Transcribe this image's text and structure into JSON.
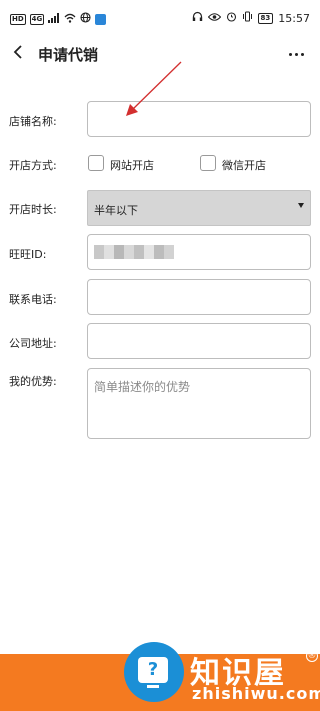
{
  "status_bar": {
    "left_tags": [
      "HD",
      "4G"
    ],
    "left_icons": [
      "signal-icon",
      "wifi-icon",
      "globe-icon",
      "app-icon"
    ],
    "right_icons": [
      "headphones-icon",
      "eye-icon",
      "alarm-icon",
      "vibrate-icon"
    ],
    "battery": "83",
    "time": "15:57"
  },
  "app_bar": {
    "title": "申请代销",
    "back_icon": "chevron-left-icon",
    "more_icon": "more-dots-icon"
  },
  "form": {
    "shop_name": {
      "label": "店铺名称:",
      "value": ""
    },
    "shop_method": {
      "label": "开店方式:",
      "options": [
        "网站开店",
        "微信开店"
      ]
    },
    "shop_duration": {
      "label": "开店时长:",
      "selected": "半年以下"
    },
    "wangwang": {
      "label": "旺旺ID:",
      "value": ""
    },
    "phone": {
      "label": "联系电话:",
      "value": ""
    },
    "address": {
      "label": "公司地址:",
      "value": ""
    },
    "advantage": {
      "label": "我的优势:",
      "placeholder": "简单描述你的优势"
    }
  },
  "annotation": {
    "arrow_color": "#d32f2f"
  },
  "watermark": {
    "text_cn": "知识屋",
    "text_en": "zhishiwu.com",
    "reg": "®",
    "bar_color": "#f47a20",
    "logo_color": "#1b8fd6"
  }
}
